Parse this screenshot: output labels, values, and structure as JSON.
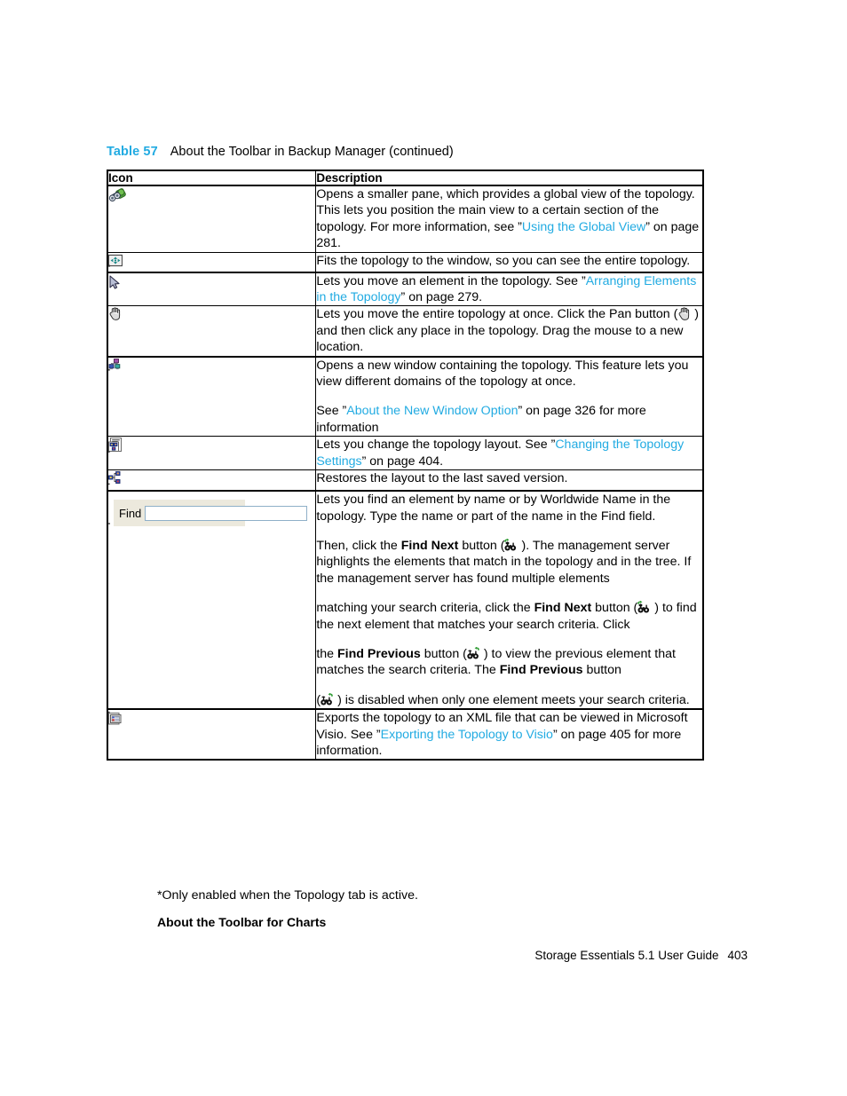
{
  "document": {
    "title": "Storage Essentials 5.1 User Guide",
    "page_number": "403"
  },
  "table": {
    "caption_number": "Table 57",
    "caption_title": "About the Toolbar in Backup Manager (continued)",
    "headers": {
      "icon": "Icon",
      "description": "Description"
    },
    "rows": [
      {
        "icon_name": "binoculars-global-view-icon",
        "paragraphs": [
          {
            "runs": [
              {
                "text": "Opens a smaller pane, which provides a global view of the topology. This lets you position the main view to a certain section of the topology. For more information, see ”",
                "style": "normal"
              },
              {
                "text": "Using the Global View",
                "style": "link"
              },
              {
                "text": "” on page 281.",
                "style": "normal"
              }
            ]
          }
        ]
      },
      {
        "icon_name": "fit-to-window-icon",
        "paragraphs": [
          {
            "runs": [
              {
                "text": "Fits the topology to the window, so you can see the entire topology.",
                "style": "normal"
              }
            ]
          }
        ]
      },
      {
        "icon_name": "arrow-pointer-icon",
        "paragraphs": [
          {
            "runs": [
              {
                "text": "Lets you move an element in the topology. See ”",
                "style": "normal"
              },
              {
                "text": "Arranging Elements in the Topology",
                "style": "link"
              },
              {
                "text": "” on page 279.",
                "style": "normal"
              }
            ]
          }
        ]
      },
      {
        "icon_name": "pan-hand-icon",
        "paragraphs": [
          {
            "runs": [
              {
                "text": "Lets you move the entire topology at once. Click the Pan button (",
                "style": "normal"
              },
              {
                "text": "pan-hand-icon",
                "style": "inline-icon"
              },
              {
                "text": ") and then click any place in the topology. Drag the mouse to a new location.",
                "style": "normal"
              }
            ]
          }
        ]
      },
      {
        "icon_name": "new-window-topology-icon",
        "paragraphs": [
          {
            "runs": [
              {
                "text": "Opens a new window containing the topology. This feature lets you view different domains of the topology at once.",
                "style": "normal"
              }
            ]
          },
          {
            "runs": [
              {
                "text": "See ”",
                "style": "normal"
              },
              {
                "text": "About the New Window Option",
                "style": "link"
              },
              {
                "text": "” on page 326 for more information",
                "style": "normal"
              }
            ]
          }
        ]
      },
      {
        "icon_name": "topology-settings-icon",
        "paragraphs": [
          {
            "runs": [
              {
                "text": "Lets you change the topology layout. See ”",
                "style": "normal"
              },
              {
                "text": "Changing the Topology Settings",
                "style": "link"
              },
              {
                "text": "” on page 404.",
                "style": "normal"
              }
            ]
          }
        ]
      },
      {
        "icon_name": "restore-layout-icon",
        "paragraphs": [
          {
            "runs": [
              {
                "text": "Restores the layout to the last saved version.",
                "style": "normal"
              }
            ]
          }
        ]
      },
      {
        "icon_name": "find-field-widget",
        "find_widget": {
          "label": "Find",
          "value": "",
          "placeholder": ""
        },
        "paragraphs": [
          {
            "runs": [
              {
                "text": "Lets you find an element by name or by Worldwide Name in the topology. Type the name or part of the name in the Find field.",
                "style": "normal"
              }
            ]
          },
          {
            "runs": [
              {
                "text": "Then, click the ",
                "style": "normal"
              },
              {
                "text": "Find Next",
                "style": "bold"
              },
              {
                "text": " button (",
                "style": "normal"
              },
              {
                "text": "find-next-icon",
                "style": "inline-icon"
              },
              {
                "text": "). The management server highlights the elements that match in the topology and in the tree. If the management server has found multiple elements",
                "style": "normal"
              }
            ]
          },
          {
            "runs": [
              {
                "text": "matching your search criteria, click the ",
                "style": "normal"
              },
              {
                "text": "Find Next",
                "style": "bold"
              },
              {
                "text": " button (",
                "style": "normal"
              },
              {
                "text": "find-next-icon",
                "style": "inline-icon"
              },
              {
                "text": ") to find the next element that matches your search criteria. Click",
                "style": "normal"
              }
            ]
          },
          {
            "runs": [
              {
                "text": "the ",
                "style": "normal"
              },
              {
                "text": "Find Previous",
                "style": "bold"
              },
              {
                "text": " button (",
                "style": "normal"
              },
              {
                "text": "find-previous-icon",
                "style": "inline-icon"
              },
              {
                "text": ") to view the previous element that matches the search criteria. The ",
                "style": "normal"
              },
              {
                "text": "Find Previous",
                "style": "bold"
              },
              {
                "text": " button",
                "style": "normal"
              }
            ]
          },
          {
            "runs": [
              {
                "text": "(",
                "style": "normal"
              },
              {
                "text": "find-previous-icon",
                "style": "inline-icon"
              },
              {
                "text": ") is disabled when only one element meets your search criteria.",
                "style": "normal"
              }
            ]
          }
        ]
      },
      {
        "icon_name": "export-visio-icon",
        "paragraphs": [
          {
            "runs": [
              {
                "text": "Exports the topology to an XML file that can be viewed in Microsoft Visio. See ”",
                "style": "normal"
              },
              {
                "text": "Exporting the Topology to Visio",
                "style": "link"
              },
              {
                "text": "” on page 405 for more information.",
                "style": "normal"
              }
            ]
          }
        ]
      }
    ]
  },
  "footnote": "*Only enabled when the Topology tab is active.",
  "sub_heading": "About the Toolbar for Charts",
  "colors": {
    "link": "#22ABE2",
    "caption_number": "#22ABE2",
    "text": "#000000",
    "find_widget_background": "#ECE9DD",
    "find_input_border": "#8FB0C8"
  }
}
